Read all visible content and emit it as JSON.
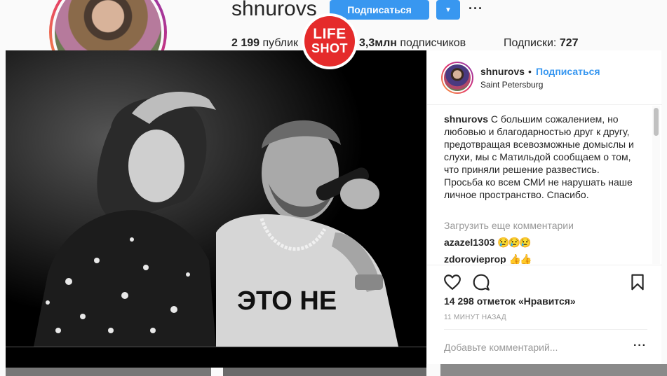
{
  "profile": {
    "username": "shnurovs",
    "follow_label": "Подписаться",
    "dropdown_icon": "▼",
    "more_icon": "···",
    "stats": {
      "posts_count": "2 199",
      "posts_label": "публик",
      "followers_count": "3,3млн",
      "followers_label": "подписчиков",
      "following_label": "Подписки:",
      "following_count": "727"
    }
  },
  "watermark": {
    "line1": "LIFE",
    "line2": "SHOT"
  },
  "post": {
    "header": {
      "username": "shnurovs",
      "separator": "•",
      "follow_label": "Подписаться",
      "location": "Saint Petersburg"
    },
    "caption": {
      "username": "shnurovs",
      "text": "С большим сожалением, но любовью и благодарностью друг к другу, предотвращая всевозможные домыслы и слухи, мы с Матильдой сообщаем о том, что приняли решение развестись. Просьба ко всем СМИ не нарушать наше личное пространство. Спасибо."
    },
    "load_more_label": "Загрузить еще комментарии",
    "comments": [
      {
        "username": "azazel1303",
        "emoji": "😢😢😢"
      },
      {
        "username": "zdorovieprop",
        "emoji": "👍👍"
      }
    ],
    "likes": "14 298 отметок «Нравится»",
    "timestamp": "11 МИНУТ НАЗАД",
    "add_comment_placeholder": "Добавьте комментарий...",
    "add_more_icon": "···",
    "photo_text": "ЭТО НЕ"
  },
  "colors": {
    "accent": "#3897f0",
    "watermark_red": "#e52b2b",
    "muted": "#999999"
  }
}
